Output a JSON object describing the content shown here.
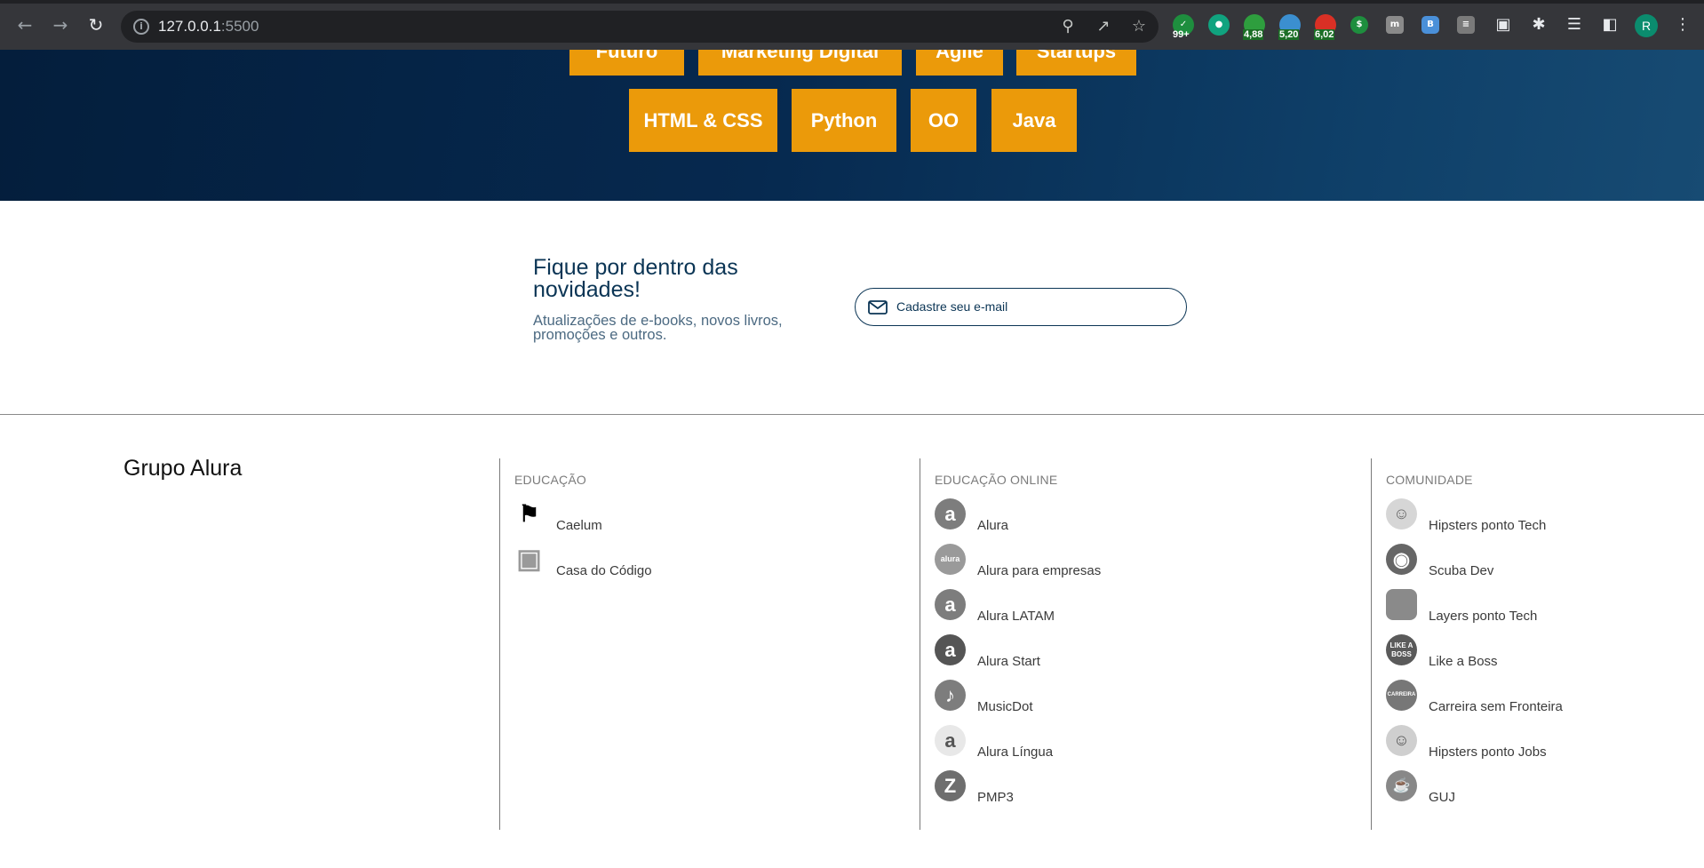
{
  "browser": {
    "url_host": "127.0.0.1",
    "url_port": ":5500",
    "extension_badges": [
      "99+",
      "4,88",
      "5,20",
      "6,02"
    ],
    "profile_initial": "R"
  },
  "banner": {
    "tags_top": [
      "Futuro",
      "Marketing Digital",
      "Agile",
      "Startups"
    ],
    "tags_bottom": [
      "HTML & CSS",
      "Python",
      "OO",
      "Java"
    ],
    "tag_color": "#eb9a0a"
  },
  "newsletter": {
    "title": "Fique por dentro das novidades!",
    "subtitle": "Atualizações de e-books, novos livros, promoções e outros.",
    "email_placeholder": "Cadastre seu e-mail"
  },
  "footer": {
    "brand": "Grupo Alura",
    "columns": [
      {
        "title": "EDUCAÇÃO",
        "items": [
          {
            "label": "Caelum",
            "icon": "caelum-icon"
          },
          {
            "label": "Casa do Código",
            "icon": "casa-do-codigo-icon"
          }
        ]
      },
      {
        "title": "EDUCAÇÃO ONLINE",
        "items": [
          {
            "label": "Alura",
            "icon": "alura-icon"
          },
          {
            "label": "Alura para empresas",
            "icon": "alura-empresas-icon"
          },
          {
            "label": "Alura LATAM",
            "icon": "alura-latam-icon"
          },
          {
            "label": "Alura Start",
            "icon": "alura-start-icon"
          },
          {
            "label": "MusicDot",
            "icon": "musicdot-icon"
          },
          {
            "label": "Alura Língua",
            "icon": "alura-lingua-icon"
          },
          {
            "label": "PMP3",
            "icon": "pmp3-icon"
          }
        ]
      },
      {
        "title": "COMUNIDADE",
        "items": [
          {
            "label": "Hipsters ponto Tech",
            "icon": "hipsters-tech-icon"
          },
          {
            "label": "Scuba Dev",
            "icon": "scuba-dev-icon"
          },
          {
            "label": "Layers ponto Tech",
            "icon": "layers-tech-icon"
          },
          {
            "label": "Like a Boss",
            "icon": "like-a-boss-icon"
          },
          {
            "label": "Carreira sem Fronteira",
            "icon": "carreira-sem-fronteira-icon"
          },
          {
            "label": "Hipsters ponto Jobs",
            "icon": "hipsters-jobs-icon"
          },
          {
            "label": "GUJ",
            "icon": "guj-icon"
          }
        ]
      }
    ]
  }
}
